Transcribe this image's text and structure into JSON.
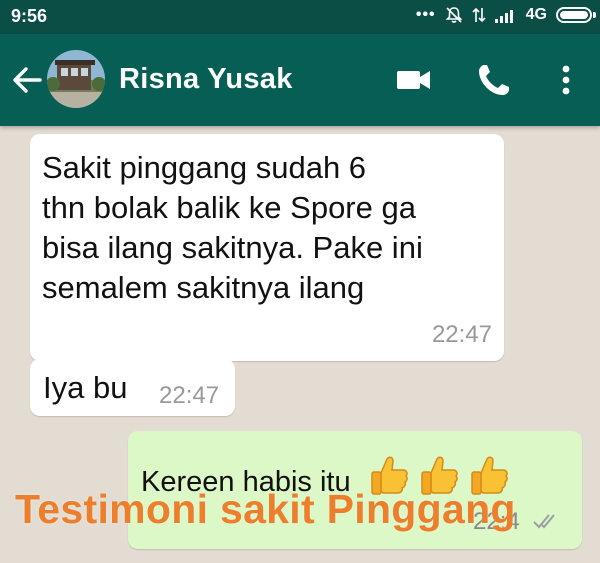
{
  "status_bar": {
    "time": "9:56",
    "network": "4G",
    "battery_level": 0.9,
    "icons": [
      "notification-dots-icon",
      "mute-icon",
      "data-arrows-icon",
      "signal-icon",
      "battery-icon"
    ]
  },
  "header": {
    "contact_name": "Risna Yusak",
    "icons": [
      "back-arrow-icon",
      "video-call-icon",
      "voice-call-icon",
      "more-options-icon"
    ]
  },
  "messages": [
    {
      "direction": "incoming",
      "lines": [
        "Sakit pinggang sudah 6",
        "thn bolak balik ke Spore ga",
        "bisa ilang sakitnya. Pake ini",
        "semalem sakitnya ilang"
      ],
      "time": "22:47"
    },
    {
      "direction": "incoming",
      "text": "Iya bu",
      "time": "22:47"
    },
    {
      "direction": "outgoing",
      "text": "Kereen habis itu",
      "emoji": [
        "thumbs-up",
        "thumbs-up",
        "thumbs-up"
      ],
      "time": "22:4",
      "status": "read-double-tick"
    }
  ],
  "overlay": {
    "watermark": "Testimoni sakit Pinggang",
    "color": "#ec7e2c"
  },
  "colors": {
    "status_bar": "#0b4e45",
    "app_bar": "#075e54",
    "chat_background": "#e3dcd3",
    "incoming_bubble": "#ffffff",
    "outgoing_bubble": "#dcf8c6"
  }
}
